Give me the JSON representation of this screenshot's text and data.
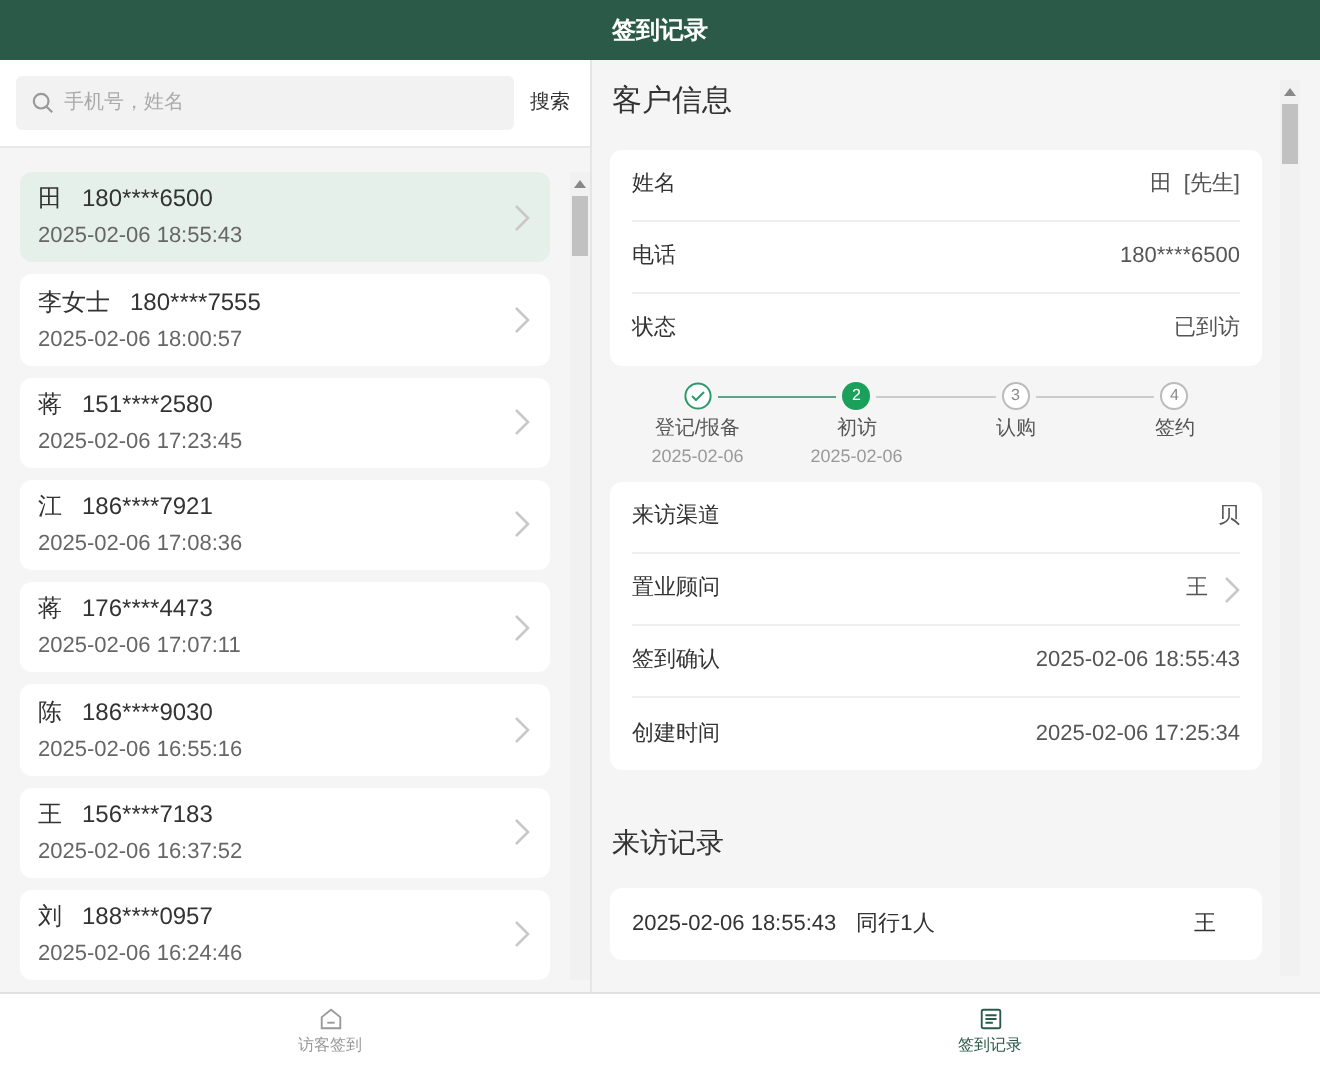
{
  "window": {
    "title": "签到记录"
  },
  "search": {
    "placeholder": "手机号，姓名",
    "button": "搜索"
  },
  "visitors": [
    {
      "name": "田",
      "phone": "180****6500",
      "time": "2025-02-06 18:55:43",
      "selected": true
    },
    {
      "name": "李女士",
      "phone": "180****7555",
      "time": "2025-02-06 18:00:57",
      "selected": false
    },
    {
      "name": "蒋",
      "phone": "151****2580",
      "time": "2025-02-06 17:23:45",
      "selected": false
    },
    {
      "name": "江",
      "phone": "186****7921",
      "time": "2025-02-06 17:08:36",
      "selected": false
    },
    {
      "name": "蒋",
      "phone": "176****4473",
      "time": "2025-02-06 17:07:11",
      "selected": false
    },
    {
      "name": "陈",
      "phone": "186****9030",
      "time": "2025-02-06 16:55:16",
      "selected": false
    },
    {
      "name": "王",
      "phone": "156****7183",
      "time": "2025-02-06 16:37:52",
      "selected": false
    },
    {
      "name": "刘",
      "phone": "188****0957",
      "time": "2025-02-06 16:24:46",
      "selected": false
    }
  ],
  "customer": {
    "title": "客户信息",
    "fields": [
      {
        "label": "姓名",
        "value": "田  [先生]"
      },
      {
        "label": "电话",
        "value": "180****6500"
      },
      {
        "label": "状态",
        "value": "已到访"
      }
    ],
    "steps": [
      {
        "label": "登记/报备",
        "date": "2025-02-06",
        "done": true
      },
      {
        "number": "2",
        "label": "初访",
        "date": "2025-02-06",
        "done": false,
        "current": true
      },
      {
        "number": "3",
        "label": "认购",
        "done": false,
        "current": false
      },
      {
        "number": "4",
        "label": "签约",
        "done": false,
        "current": false
      }
    ],
    "details": [
      {
        "label": "来访渠道",
        "value": "贝",
        "link": false
      },
      {
        "label": "置业顾问",
        "value": "王",
        "link": true
      },
      {
        "label": "签到确认",
        "value": "2025-02-06 18:55:43",
        "link": false
      },
      {
        "label": "创建时间",
        "value": "2025-02-06 17:25:34",
        "link": false
      }
    ]
  },
  "visits": {
    "title": "来访记录",
    "records": [
      {
        "time": "2025-02-06 18:55:43",
        "companions": "同行1人",
        "consultant": "王"
      }
    ]
  },
  "tabbar": [
    {
      "label": "访客签到",
      "selected": false
    },
    {
      "label": "签到记录",
      "selected": true
    }
  ]
}
